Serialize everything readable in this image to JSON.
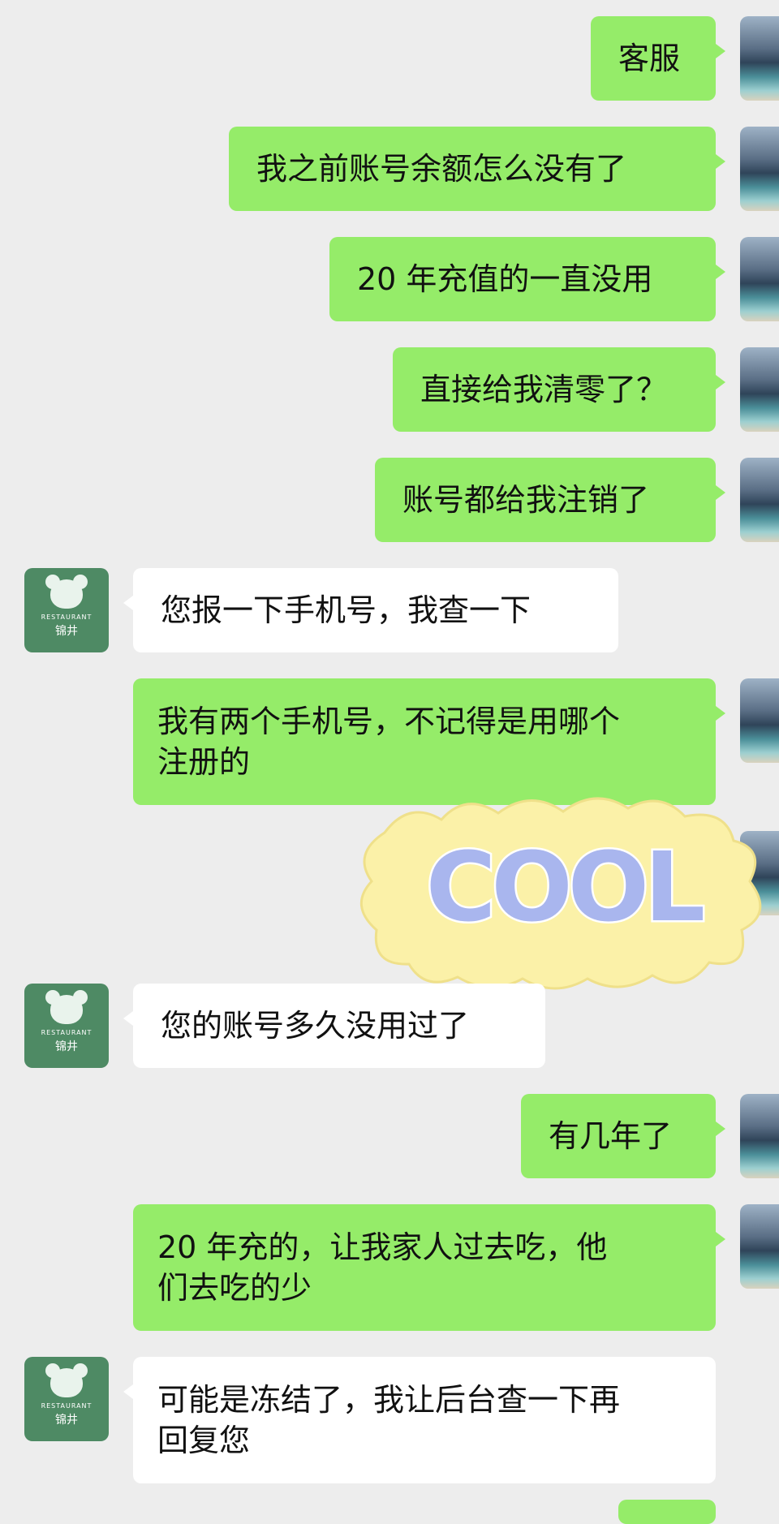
{
  "chat": {
    "messages": [
      {
        "from": "me",
        "text": "客服"
      },
      {
        "from": "me",
        "text": "我之前账号余额怎么没有了"
      },
      {
        "from": "me",
        "text": "20 年充值的一直没用"
      },
      {
        "from": "me",
        "text": "直接给我清零了？"
      },
      {
        "from": "me",
        "text": "账号都给我注销了"
      },
      {
        "from": "them",
        "text": "您报一下手机号，我查一下"
      },
      {
        "from": "me",
        "text": "我有两个手机号，不记得是用哪个\n注册的"
      },
      {
        "from": "me",
        "type": "sticker",
        "sticker_text": "COOL"
      },
      {
        "from": "them",
        "text": "您的账号多久没用过了"
      },
      {
        "from": "me",
        "text": "有几年了"
      },
      {
        "from": "me",
        "text": "20 年充的，让我家人过去吃，他\n们去吃的少"
      },
      {
        "from": "them",
        "text": "可能是冻结了，我让后台查一下再\n回复您"
      }
    ]
  },
  "agent_avatar": {
    "brand_en": "RESTAURANT",
    "brand_cn": "锦井",
    "logo_char": "锦"
  },
  "colors": {
    "bg": "#ededed",
    "me_bubble": "#95ec69",
    "them_bubble": "#ffffff",
    "agent_avatar": "#4e8a64"
  }
}
